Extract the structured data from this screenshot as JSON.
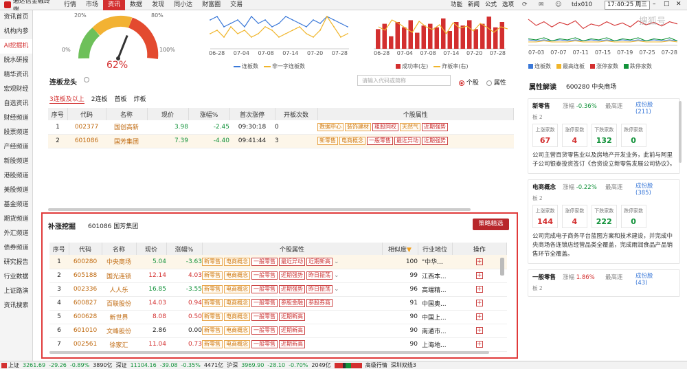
{
  "app": {
    "title": "通达信金融终端"
  },
  "menu": [
    "行情",
    "市场",
    "资讯",
    "数据",
    "发现",
    "同小达",
    "财富圈",
    "交易"
  ],
  "right_menu": [
    "功能",
    "新闻",
    "公式",
    "选项"
  ],
  "account": "tdx010",
  "clock": "17:40:25 周三",
  "watermark": "搜狐号",
  "sidebar": [
    "资讯首页",
    "机构内参",
    "AI挖掘机",
    "脱水研报",
    "精华资讯",
    "宏观财经",
    "自选资讯",
    "财经频道",
    "股票频道",
    "产经频道",
    "新股频道",
    "港股频道",
    "美股频道",
    "基金频道",
    "期货频道",
    "外汇频道",
    "债券频道",
    "研究报告",
    "行业数据",
    "上证路演",
    "资讯搜索"
  ],
  "gauge": {
    "value": "62%",
    "pct": 62,
    "lbl_20": "20%",
    "lbl_80": "80%",
    "lbl_0": "0%",
    "lbl_100": "100%"
  },
  "chart2": {
    "xticks": [
      "06-28",
      "07-04",
      "07-08",
      "07-14",
      "07-20",
      "07-28"
    ],
    "legend": [
      "连板数",
      "非一字连板数"
    ]
  },
  "chart3": {
    "xticks": [
      "06-28",
      "07-04",
      "07-08",
      "07-14",
      "07-20",
      "07-28"
    ],
    "legend": [
      "成功率(左)",
      "炸板率(右)"
    ]
  },
  "chart4": {
    "xticks": [
      "07-03",
      "07-07",
      "07-11",
      "07-15",
      "07-19",
      "07-25",
      "07-28"
    ],
    "legend": [
      "连板数",
      "最高连板",
      "涨停家数",
      "跌停家数"
    ]
  },
  "chart_data": [
    {
      "type": "line",
      "xticks": [
        "06-28",
        "07-04",
        "07-08",
        "07-14",
        "07-20",
        "07-28"
      ],
      "series": [
        {
          "name": "连板数",
          "values": [
            8,
            9,
            6,
            7,
            8,
            6,
            9,
            7,
            8,
            6,
            7,
            9,
            8,
            7,
            6,
            8,
            7,
            9,
            8,
            7,
            6
          ]
        },
        {
          "name": "非一字连板数",
          "values": [
            4,
            5,
            3,
            6,
            4,
            5,
            3,
            4,
            6,
            5,
            3,
            4,
            5,
            6,
            4,
            3,
            5,
            9,
            6,
            3,
            4
          ]
        }
      ]
    },
    {
      "type": "bar",
      "xticks": [
        "06-28",
        "07-04",
        "07-08",
        "07-14",
        "07-20",
        "07-28"
      ],
      "series": [
        {
          "name": "成功率(左)",
          "values": [
            55,
            70,
            35,
            75,
            60,
            80,
            45,
            65,
            70,
            60,
            85,
            50,
            75,
            65,
            80,
            55,
            70,
            90,
            60,
            75
          ]
        },
        {
          "name": "炸板率(右)",
          "values": [
            30,
            25,
            40,
            35,
            28,
            22,
            38,
            30,
            26,
            33,
            20,
            36,
            28,
            31,
            24,
            35,
            29,
            22,
            30,
            27
          ]
        }
      ]
    },
    {
      "type": "line",
      "xticks": [
        "07-03",
        "07-07",
        "07-11",
        "07-15",
        "07-19",
        "07-25",
        "07-28"
      ],
      "series": [
        {
          "name": "连板数",
          "values": [
            4,
            3,
            4,
            3,
            4,
            3,
            4,
            3,
            4,
            3,
            4,
            3,
            4,
            3,
            4,
            3,
            4,
            3,
            4,
            3
          ]
        },
        {
          "name": "最高连板",
          "values": [
            2,
            2,
            3,
            2,
            2,
            2,
            3,
            2,
            2,
            2,
            3,
            2,
            2,
            2,
            3,
            2,
            2,
            2,
            3,
            2
          ]
        },
        {
          "name": "涨停家数",
          "values": [
            80,
            60,
            72,
            55,
            70,
            62,
            75,
            50,
            65,
            58,
            72,
            60,
            68,
            55,
            75,
            62,
            70,
            58,
            72,
            65
          ]
        },
        {
          "name": "跌停家数",
          "values": [
            5,
            4,
            6,
            3,
            5,
            4,
            6,
            3,
            5,
            4,
            6,
            3,
            5,
            4,
            6,
            3,
            5,
            4,
            6,
            3
          ]
        }
      ]
    }
  ],
  "dragon": {
    "title": "连板龙头",
    "subtabs": [
      "3连板及以上",
      "2连板",
      "首板",
      "炸板"
    ],
    "search_placeholder": "请输入代码或简称",
    "radio_stock": "个股",
    "radio_attr": "属性",
    "headers": [
      "序号",
      "代码",
      "名称",
      "现价",
      "涨幅%",
      "首次涨停",
      "开板次数",
      "个股属性"
    ],
    "rows": [
      {
        "no": "1",
        "code": "002377",
        "name": "国创高新",
        "price": "3.98",
        "chg": "-2.45",
        "first": "09:30:18",
        "open": "0",
        "tags": [
          "数据中心",
          "装饰建材",
          "粗股同权",
          "天然气",
          "近期强势"
        ]
      },
      {
        "no": "2",
        "code": "601086",
        "name": "国芳集团",
        "price": "7.39",
        "chg": "-4.40",
        "first": "09:41:44",
        "open": "3",
        "tags": [
          "新零售",
          "电商概念",
          "一般零售",
          "最近异动",
          "近期强势"
        ]
      }
    ]
  },
  "dig": {
    "title": "补涨挖掘",
    "stock": "601086 国芳集团",
    "btn": "策略精选",
    "headers": [
      "序号",
      "代码",
      "名称",
      "现价",
      "涨幅%",
      "个股属性",
      "相似度",
      "行业地位",
      "操作"
    ],
    "rows": [
      {
        "no": "1",
        "code": "600280",
        "name": "中央商场",
        "price": "5.04",
        "chg": "-3.63",
        "tags": [
          "新零售",
          "电商概念",
          "一般零售",
          "最近异动",
          "近期新高"
        ],
        "sim": "100",
        "ind": "\"中华...",
        "hl": true
      },
      {
        "no": "2",
        "code": "605188",
        "name": "国光连锁",
        "price": "12.14",
        "chg": "4.03",
        "tags": [
          "新零售",
          "电商概念",
          "一般零售",
          "近期强势",
          "昨日振荡"
        ],
        "sim": "99",
        "ind": "江西本..."
      },
      {
        "no": "3",
        "code": "002336",
        "name": "人人乐",
        "price": "16.85",
        "chg": "-3.55",
        "tags": [
          "新零售",
          "电商概念",
          "一般零售",
          "近期强势",
          "昨日振荡"
        ],
        "sim": "96",
        "ind": "高端精..."
      },
      {
        "no": "4",
        "code": "600827",
        "name": "百联股份",
        "price": "14.03",
        "chg": "0.94",
        "tags": [
          "新零售",
          "电商概念",
          "一般零售",
          "参股金融",
          "参股券商"
        ],
        "sim": "91",
        "ind": "中国奥..."
      },
      {
        "no": "5",
        "code": "600628",
        "name": "新世界",
        "price": "8.08",
        "chg": "0.50",
        "tags": [
          "新零售",
          "电商概念",
          "一般零售",
          "近期新高"
        ],
        "sim": "90",
        "ind": "中国上..."
      },
      {
        "no": "6",
        "code": "601010",
        "name": "文峰股份",
        "price": "2.86",
        "chg": "0.00",
        "tags": [
          "新零售",
          "电商概念",
          "一般零售",
          "近期新高"
        ],
        "sim": "90",
        "ind": "南通市..."
      },
      {
        "no": "7",
        "code": "002561",
        "name": "徐家汇",
        "price": "11.04",
        "chg": "0.73",
        "tags": [
          "新零售",
          "电商概念",
          "一般零售",
          "近期新高"
        ],
        "sim": "90",
        "ind": "上海地..."
      }
    ]
  },
  "attr": {
    "title": "属性解读",
    "stock": "600280 中央商场",
    "blocks": [
      {
        "name": "新零售",
        "chg_label": "涨幅",
        "chg": "-0.36%",
        "high_label": "最高连",
        "high": "板 2",
        "stocks_label": "成份股",
        "stocks": "(211)",
        "up": "67",
        "zt": "4",
        "down": "132",
        "dt": "0",
        "desc": "公司主营百货零售业以及房地产开发业务，此前与阿里子公司银泰投资签订《合资设立新零售发展公司协议》。"
      },
      {
        "name": "电商概念",
        "chg_label": "涨幅",
        "chg": "-0.22%",
        "high_label": "最高连",
        "high": "板 2",
        "stocks_label": "成份股",
        "stocks": "(385)",
        "up": "144",
        "zt": "4",
        "down": "222",
        "dt": "0",
        "desc": "公司完成电子商务平台蓝图方案和技术建设，并完成中央商场各连锁店经营品类全覆盖，完成雨润食品产品销售环节全覆盖。"
      },
      {
        "name": "一般零售",
        "chg_label": "涨幅",
        "chg": "1.86%",
        "high_label": "最高连",
        "high": "板 2",
        "stocks_label": "成份股",
        "stocks": "(43)"
      }
    ],
    "stat_labels": [
      "上涨家数",
      "涨停家数",
      "下跌家数",
      "跌停家数"
    ]
  },
  "status": {
    "sh": "上证",
    "sh_val": "3261.69",
    "sh_chg": "-29.26",
    "sh_pct": "-0.89%",
    "sh_vol": "3890亿",
    "sz": "深证",
    "sz_val": "11104.16",
    "sz_chg": "-39.08",
    "sz_pct": "-0.35%",
    "sz_vol": "4471亿",
    "hs": "沪深",
    "hs_val": "3969.90",
    "hs_chg": "-28.10",
    "hs_pct": "-0.70%",
    "hs_vol": "2049亿",
    "adv": "高级行情",
    "feed": "深圳双线3"
  }
}
